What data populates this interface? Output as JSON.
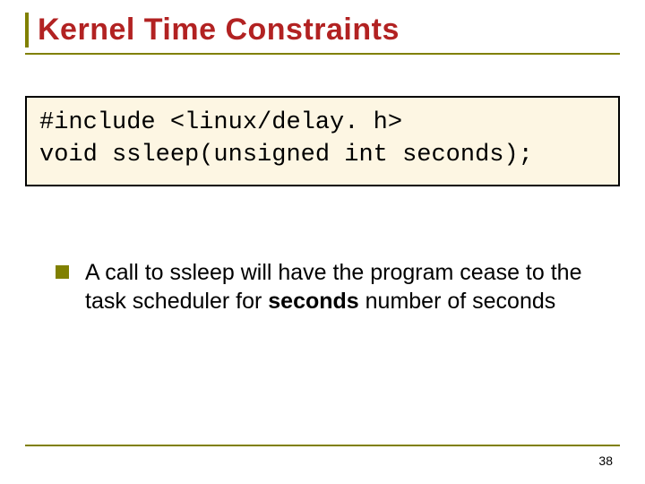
{
  "title": "Kernel Time Constraints",
  "code": {
    "line1": "#include <linux/delay. h>",
    "line2": "void ssleep(unsigned int seconds);"
  },
  "bullet": {
    "part1": "A call to ssleep will have the program cease to the task scheduler for ",
    "bold1": "seconds",
    "part2": " number of seconds"
  },
  "page_number": "38"
}
